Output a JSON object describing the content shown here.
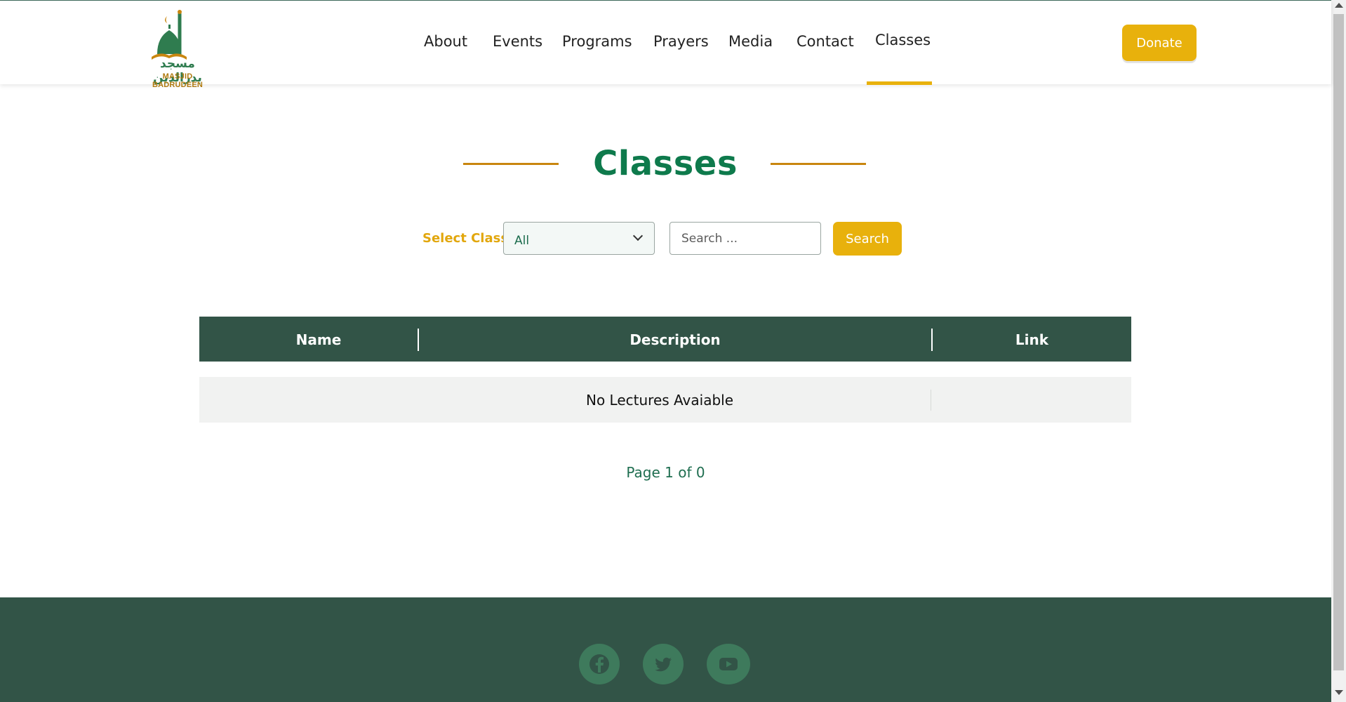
{
  "header": {
    "logo_text_ar": "مسجد بدرالدين",
    "logo_text_en": "MASJID BADRUDEEN",
    "nav": [
      {
        "label": "About"
      },
      {
        "label": "Events"
      },
      {
        "label": "Programs"
      },
      {
        "label": "Prayers"
      },
      {
        "label": "Media"
      },
      {
        "label": "Contact"
      },
      {
        "label": "Classes",
        "active": true
      }
    ],
    "donate_label": "Donate"
  },
  "main": {
    "title": "Classes",
    "filters": {
      "select_label": "Select Class",
      "select_value": "All",
      "search_placeholder": "Search ...",
      "search_button": "Search"
    },
    "table": {
      "columns": [
        "Name",
        "Description",
        "Link"
      ],
      "empty_message": "No Lectures Avaiable"
    },
    "pagination": "Page 1 of 0"
  },
  "footer": {
    "social_icons": [
      "facebook-icon",
      "twitter-icon",
      "youtube-icon"
    ]
  },
  "colors": {
    "primary_green": "#325447",
    "title_green": "#0e7a4c",
    "accent_gold": "#e8b10c",
    "line_gold": "#c9860f"
  }
}
